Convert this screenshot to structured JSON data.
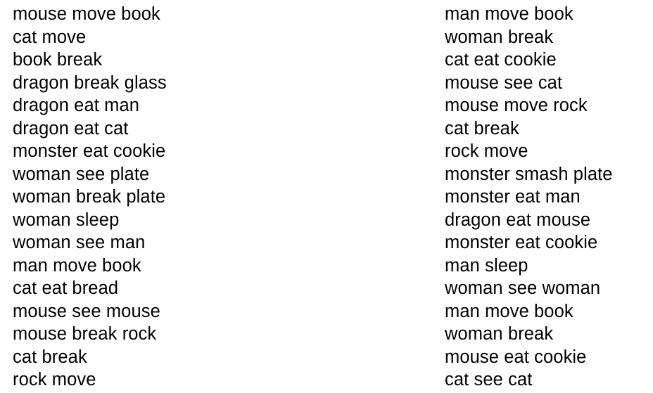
{
  "left_column": [
    "mouse move book",
    "cat move",
    "book break",
    "dragon break glass",
    "dragon eat man",
    "dragon eat cat",
    "monster eat cookie",
    "woman see plate",
    "woman break plate",
    "woman sleep",
    "woman see man",
    "man move book",
    "cat eat bread",
    "mouse see mouse",
    "mouse break rock",
    "cat break",
    "rock move"
  ],
  "right_column": [
    "man move book",
    "woman break",
    "cat eat cookie",
    "mouse see cat",
    "mouse move rock",
    "cat break",
    "rock move",
    "monster smash plate",
    "monster eat man",
    "dragon eat mouse",
    "monster eat cookie",
    "man sleep",
    "woman see woman",
    "man move book",
    "woman break",
    "mouse eat cookie",
    "cat see cat"
  ]
}
